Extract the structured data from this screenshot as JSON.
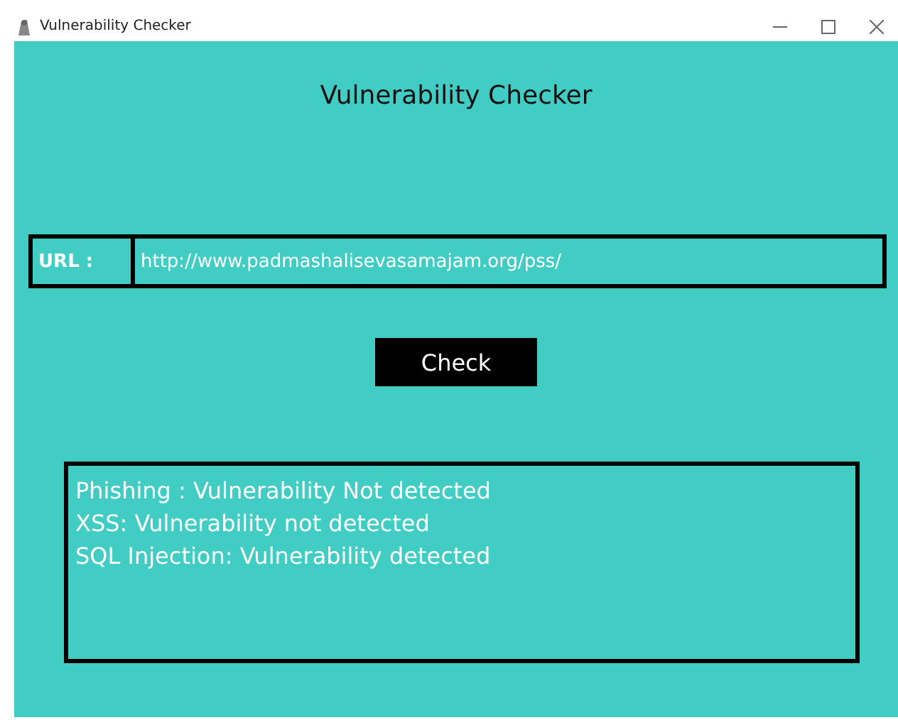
{
  "window": {
    "title": "Vulnerability Checker"
  },
  "heading": "Vulnerability Checker",
  "url_field": {
    "label": "URL :",
    "value": "http://www.padmashalisevasamajam.org/pss/"
  },
  "check_button": "Check",
  "results": [
    "Phishing : Vulnerability Not detected",
    "XSS: Vulnerability not detected",
    "SQL Injection: Vulnerability detected"
  ]
}
